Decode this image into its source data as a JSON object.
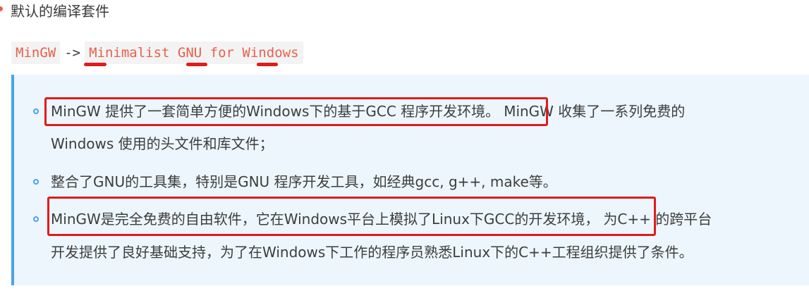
{
  "heading": {
    "text": "默认的编译套件"
  },
  "code_line": {
    "abbr": "MinGW",
    "arrow": "->",
    "expansion": "Minimalist GNU for Windows"
  },
  "items": [
    {
      "line1_highlight": "MinGW 提供了一套简单方便的Windows下的基于GCC 程序开发环境。",
      "line1_rest": "MinGW 收集了一系列免费的",
      "line2": "Windows 使用的头文件和库文件；"
    },
    {
      "line1": "整合了GNU的工具集，特别是GNU 程序开发工具，如经典gcc, g++, make等。"
    },
    {
      "line1_highlight": "MinGW是完全免费的自由软件，它在Windows平台上模拟了Linux下GCC的开发环境，",
      "line1_rest": "为C++ 的跨平台",
      "line2": "开发提供了良好基础支持，为了在Windows下工作的程序员熟悉Linux下的C++工程组织提供了条件。"
    }
  ],
  "colors": {
    "accent_red": "#e11b1b",
    "code_text": "#e8604c",
    "quote_bar": "#4ba3ea",
    "quote_bg": "#edf6fd"
  }
}
